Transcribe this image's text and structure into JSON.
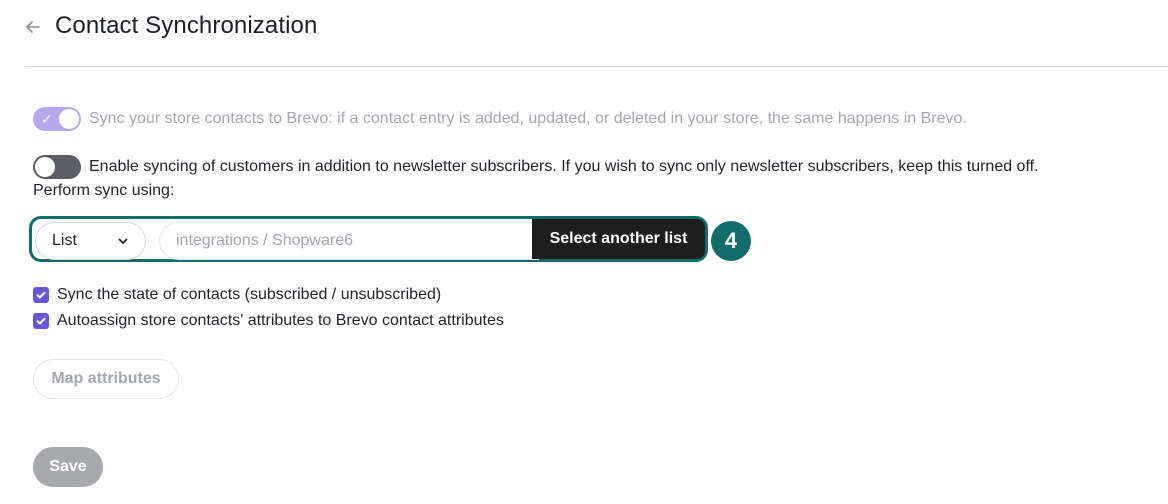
{
  "header": {
    "back_icon": "arrow-left-icon",
    "title": "Contact Synchronization"
  },
  "sync_store": {
    "enabled": true,
    "disabled_state": true,
    "label": "Sync your store contacts to Brevo: if a contact entry is added, updated, or deleted in your store, the same happens in Brevo."
  },
  "sync_customers": {
    "enabled": false,
    "label": "Enable syncing of customers in addition to newsletter subscribers. If you wish to sync only newsletter subscribers, keep this turned off."
  },
  "perform_sync": {
    "label": "Perform sync using:",
    "select_value": "List",
    "list_placeholder": "integrations / Shopware6",
    "select_button": "Select another list",
    "step_number": "4"
  },
  "options": [
    {
      "label": "Sync the state of contacts (subscribed / unsubscribed)",
      "checked": true
    },
    {
      "label": "Autoassign store contacts' attributes to Brevo contact attributes",
      "checked": true
    }
  ],
  "buttons": {
    "map_attributes": "Map attributes",
    "save": "Save"
  },
  "colors": {
    "accent_teal": "#136c6c",
    "checkbox_purple": "#6b54d6",
    "toggle_on_disabled": "#b7a7ef",
    "toggle_off": "#5b5e63"
  }
}
